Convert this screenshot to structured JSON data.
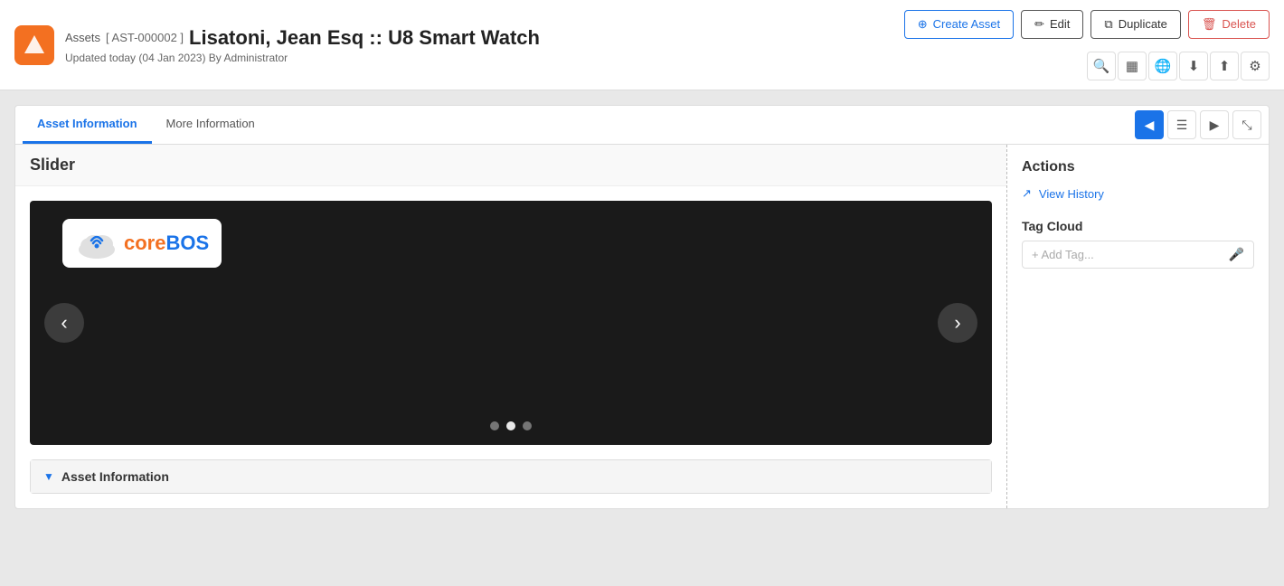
{
  "app": {
    "icon_label": "▲",
    "breadcrumb": "Assets",
    "record_id": "[ AST-000002 ]",
    "record_title": "Lisatoni, Jean Esq :: U8 Smart Watch",
    "updated_meta": "Updated today (04 Jan 2023) By Administrator"
  },
  "header_buttons": {
    "create_asset": "Create Asset",
    "edit": "Edit",
    "duplicate": "Duplicate",
    "delete": "Delete"
  },
  "tabs": {
    "asset_information": "Asset Information",
    "more_information": "More Information"
  },
  "slider": {
    "title": "Slider",
    "logo_core": "core",
    "logo_bos": "BOS",
    "dots": [
      false,
      true,
      false
    ]
  },
  "actions_sidebar": {
    "title": "Actions",
    "view_history": "View History",
    "tag_cloud_title": "Tag Cloud",
    "add_tag_placeholder": "+ Add Tag..."
  },
  "asset_info_section": {
    "title": "Asset Information",
    "chevron": "▼"
  },
  "icon_toolbar": {
    "search": "🔍",
    "grid": "▦",
    "globe": "🌐",
    "download": "⬇",
    "upload": "⬆",
    "settings": "⚙"
  }
}
